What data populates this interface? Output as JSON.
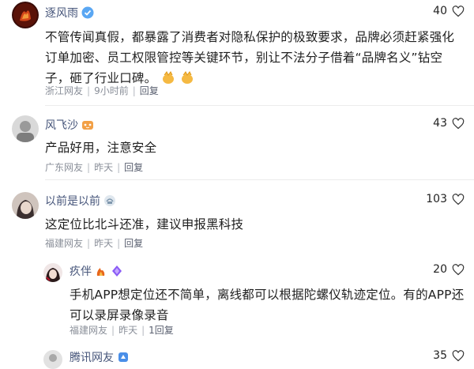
{
  "comments": [
    {
      "username": "逐风雨",
      "text": "不管传闻真假，都暴露了消费者对隐私保护的极致要求，品牌必须赶紧强化订单加密、员工权限管控等关键环节，别让不法分子借着“品牌名义”钻空子，砸了行业口碑。",
      "emojis": [
        "clap-emoji",
        "clap-emoji"
      ],
      "region": "浙江网友",
      "time": "9小时前",
      "reply_label": "回复",
      "likes": "40"
    },
    {
      "username": "风飞沙",
      "text": "产品好用，注意安全",
      "region": "广东网友",
      "time": "昨天",
      "reply_label": "回复",
      "likes": "43"
    },
    {
      "username": "以前是以前",
      "text": "这定位比北斗还准，建议申报黑科技",
      "region": "福建网友",
      "time": "昨天",
      "reply_label": "回复",
      "likes": "103"
    },
    {
      "username": "疚伴",
      "text": "手机APP想定位还不简单，离线都可以根据陀螺仪轨迹定位。有的APP还可以录屏录像录音",
      "region": "福建网友",
      "time": "昨天",
      "reply_label": "1回复",
      "likes": "20"
    },
    {
      "username": "腾讯网友",
      "likes": "35"
    }
  ],
  "colors": {
    "username": "#46557a",
    "meta": "#8a8f99",
    "text": "#1f1f1f"
  }
}
